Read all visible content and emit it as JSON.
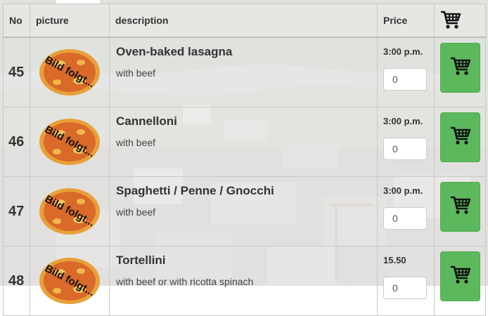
{
  "table": {
    "headers": {
      "no": "No",
      "picture": "picture",
      "description": "description",
      "price": "Price"
    },
    "header_cart_icon": "shopping-cart-icon",
    "rows": [
      {
        "no": "45",
        "picture_label": "Bild folgt...",
        "name": "Oven-baked lasagna",
        "detail": "with beef",
        "price": "3:00 p.m.",
        "qty": "0"
      },
      {
        "no": "46",
        "picture_label": "Bild folgt...",
        "name": "Cannelloni",
        "detail": "with beef",
        "price": "3:00 p.m.",
        "qty": "0"
      },
      {
        "no": "47",
        "picture_label": "Bild folgt...",
        "name": "Spaghetti / Penne / Gnocchi",
        "detail": "with beef",
        "price": "3:00 p.m.",
        "qty": "0"
      },
      {
        "no": "48",
        "picture_label": "Bild folgt...",
        "name": "Tortellini",
        "detail": "with beef or with ricotta spinach",
        "price": "15.50",
        "qty": "0"
      }
    ]
  },
  "colors": {
    "cart_button": "#5cb85c",
    "pizza_crust": "#e8a03a",
    "pizza_sauce": "#d96a2a"
  }
}
